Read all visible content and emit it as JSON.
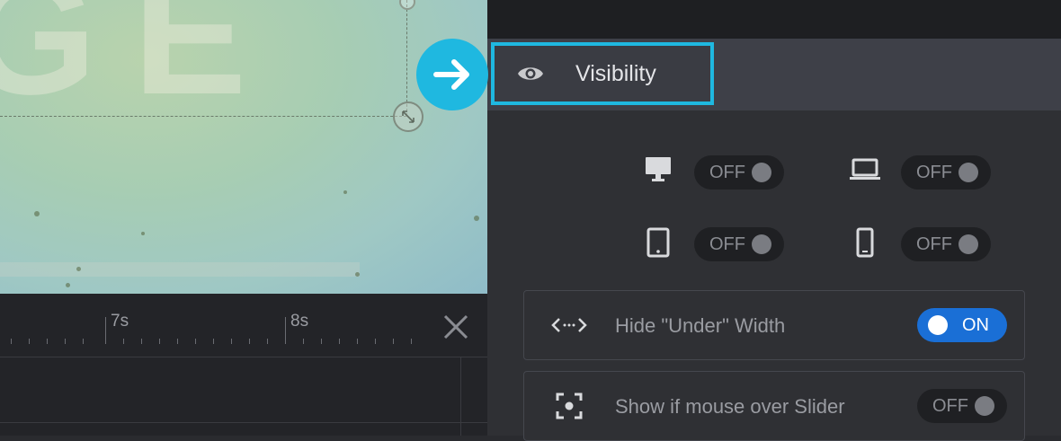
{
  "canvas": {
    "letters": "GE"
  },
  "timeline": {
    "ticks": [
      {
        "label": "7s"
      },
      {
        "label": "8s"
      }
    ]
  },
  "panel": {
    "tab": {
      "label": "Visibility",
      "icon": "eye-icon"
    },
    "devices": [
      {
        "name": "desktop",
        "icon": "desktop-icon",
        "state": "OFF"
      },
      {
        "name": "laptop",
        "icon": "laptop-icon",
        "state": "OFF"
      },
      {
        "name": "tablet",
        "icon": "tablet-icon",
        "state": "OFF"
      },
      {
        "name": "mobile",
        "icon": "mobile-icon",
        "state": "OFF"
      }
    ],
    "options": [
      {
        "label": "Hide \"Under\" Width",
        "icon": "width-arrows-icon",
        "state": "ON"
      },
      {
        "label": "Show if mouse over Slider",
        "icon": "focus-target-icon",
        "state": "OFF"
      }
    ]
  },
  "colors": {
    "accent": "#1fb8e0",
    "toggle_on": "#1a6fd6"
  }
}
